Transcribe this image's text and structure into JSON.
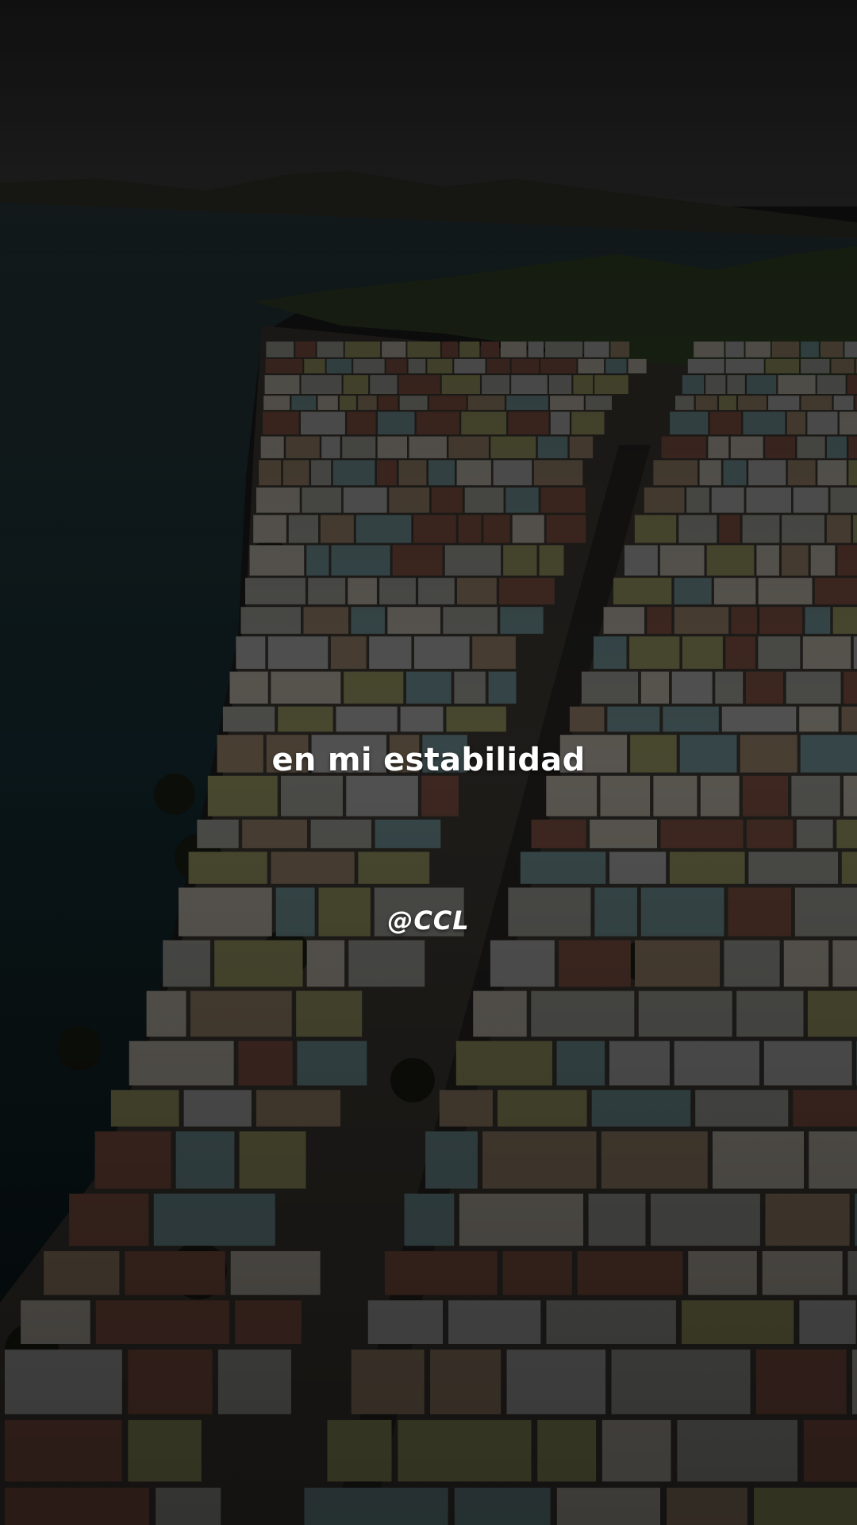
{
  "caption": {
    "text": "en mi estabilidad"
  },
  "watermark": {
    "text": "@CCL"
  },
  "scene": {
    "overlay_color": "#000000",
    "sky_color": "#2a2b2c",
    "sea_color": "#0f1f24",
    "hill_color": "#25301c",
    "roof_colors": [
      "#6d6d69",
      "#807c74",
      "#6a5a4a",
      "#5b3a30",
      "#6a6a46",
      "#4f6668",
      "#777777"
    ]
  }
}
